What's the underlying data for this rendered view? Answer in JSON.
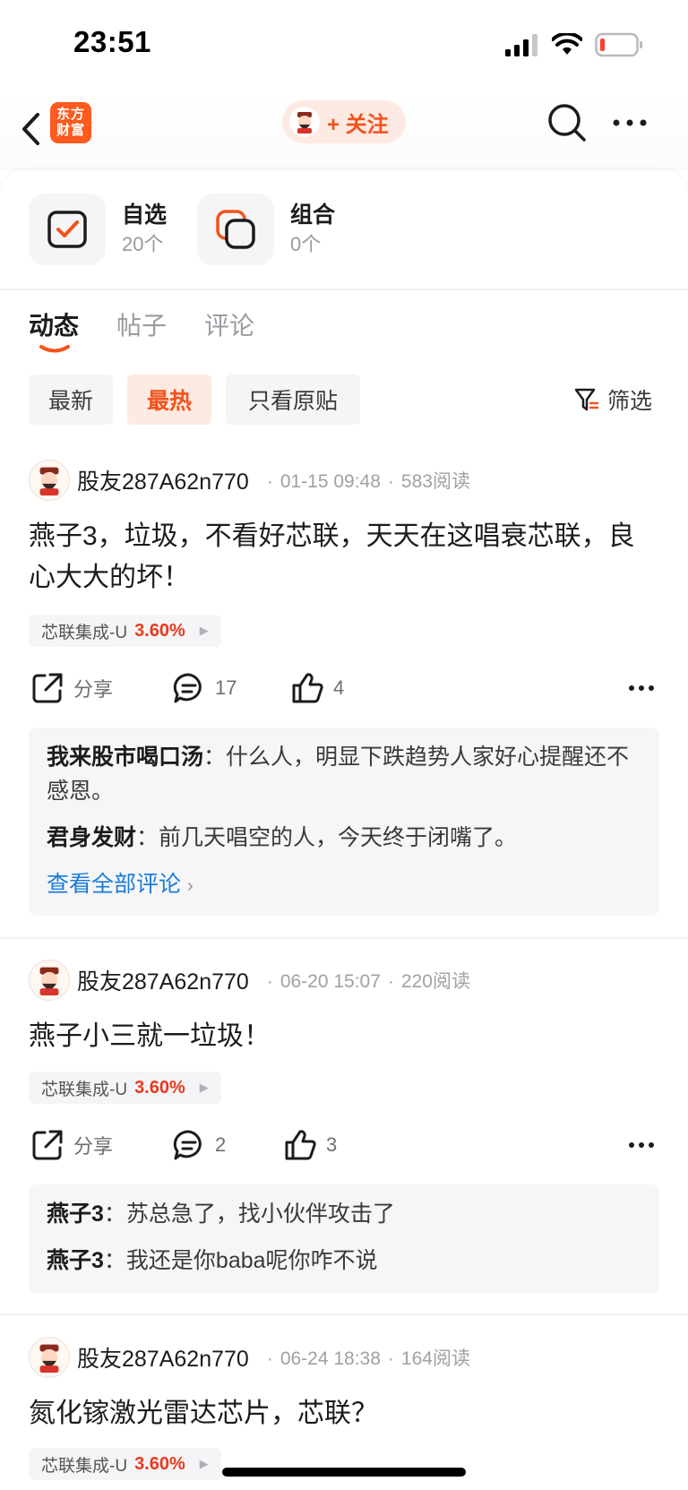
{
  "status_bar": {
    "time": "23:51"
  },
  "nav": {
    "logo_line1": "东方",
    "logo_line2": "财富",
    "follow_label": "+ 关注"
  },
  "shortcuts": [
    {
      "label": "自选",
      "count": "20个"
    },
    {
      "label": "组合",
      "count": "0个"
    }
  ],
  "tabs": [
    {
      "label": "动态",
      "active": true
    },
    {
      "label": "帖子",
      "active": false
    },
    {
      "label": "评论",
      "active": false
    }
  ],
  "filters": [
    {
      "label": "最新",
      "active": false
    },
    {
      "label": "最热",
      "active": true
    },
    {
      "label": "只看原贴",
      "active": false
    }
  ],
  "filter_button_label": "筛选",
  "colors": {
    "accent": "#f2531b",
    "rise": "#e8391e",
    "link": "#1b7bd6"
  },
  "posts": [
    {
      "author": "股友287A62n770",
      "time": "01-15 09:48",
      "reads": "583阅读",
      "body": "燕子3，垃圾，不看好芯联，天天在这唱衰芯联，良心大大的坏！",
      "stock": {
        "name": "芯联集成-U",
        "change": "3.60%"
      },
      "share_label": "分享",
      "comment_count": "17",
      "like_count": "4",
      "comments": [
        {
          "author": "我来股市喝口汤",
          "text": "什么人，明显下跌趋势人家好心提醒还不感恩。"
        },
        {
          "author": "君身发财",
          "text": "前几天唱空的人，今天终于闭嘴了。"
        }
      ],
      "view_all": "查看全部评论"
    },
    {
      "author": "股友287A62n770",
      "time": "06-20 15:07",
      "reads": "220阅读",
      "body": "燕子小三就一垃圾！",
      "stock": {
        "name": "芯联集成-U",
        "change": "3.60%"
      },
      "share_label": "分享",
      "comment_count": "2",
      "like_count": "3",
      "comments": [
        {
          "author": "燕子3",
          "text": "苏总急了，找小伙伴攻击了"
        },
        {
          "author": "燕子3",
          "text": "我还是你baba呢你咋不说"
        }
      ]
    },
    {
      "author": "股友287A62n770",
      "time": "06-24 18:38",
      "reads": "164阅读",
      "body": "氮化镓激光雷达芯片，芯联？",
      "stock": {
        "name": "芯联集成-U",
        "change": "3.60%"
      }
    }
  ]
}
